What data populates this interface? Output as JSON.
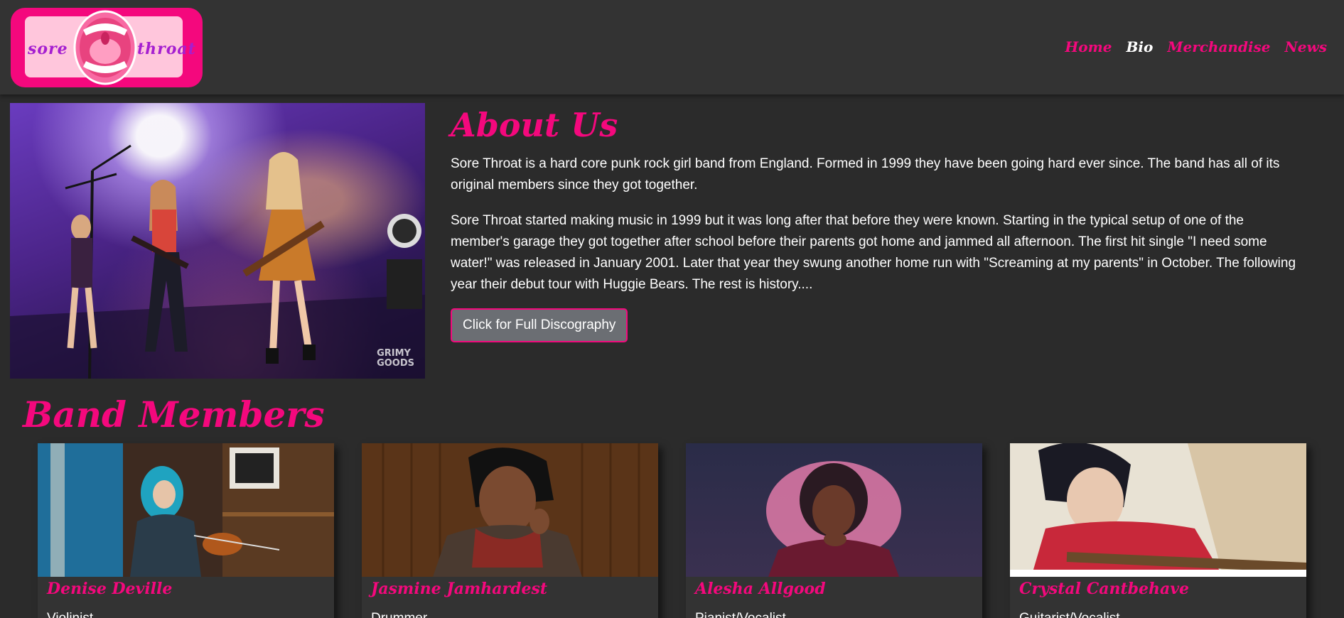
{
  "brand": {
    "logo_left": "sore",
    "logo_right": "throat",
    "pink": "#f4087d",
    "logo_bg": "#ffc6dc",
    "logo_text": "#a51fd0"
  },
  "nav": {
    "items": [
      {
        "label": "Home",
        "active": false
      },
      {
        "label": "Bio",
        "active": true
      },
      {
        "label": "Merchandise",
        "active": false
      },
      {
        "label": "News",
        "active": false
      }
    ]
  },
  "hero": {
    "watermark_line1": "GRIMY",
    "watermark_line2": "GOODS"
  },
  "about": {
    "title": "About Us",
    "paragraph1": "Sore Throat is a hard core punk rock girl band from England. Formed in 1999 they have been going hard ever since. The band has all of its original members since they got together.",
    "paragraph2": "Sore Throat started making music in 1999 but it was long after that before they were known. Starting in the typical setup of one of the member's garage they got together after school before their parents got home and jammed all afternoon. The first hit single \"I need some water!\" was released in January 2001. Later that year they swung another home run with \"Screaming at my parents\" in October. The following year their debut tour with Huggie Bears. The rest is history....",
    "button_label": "Click for Full Discography"
  },
  "members": {
    "title": "Band Members",
    "cards": [
      {
        "name": "Denise Deville",
        "role": "Violinist"
      },
      {
        "name": "Jasmine Jamhardest",
        "role": "Drummer"
      },
      {
        "name": "Alesha Allgood",
        "role": "Pianist/Vocalist"
      },
      {
        "name": "Crystal Cantbehave",
        "role": "Guitarist/Vocalist"
      }
    ]
  }
}
